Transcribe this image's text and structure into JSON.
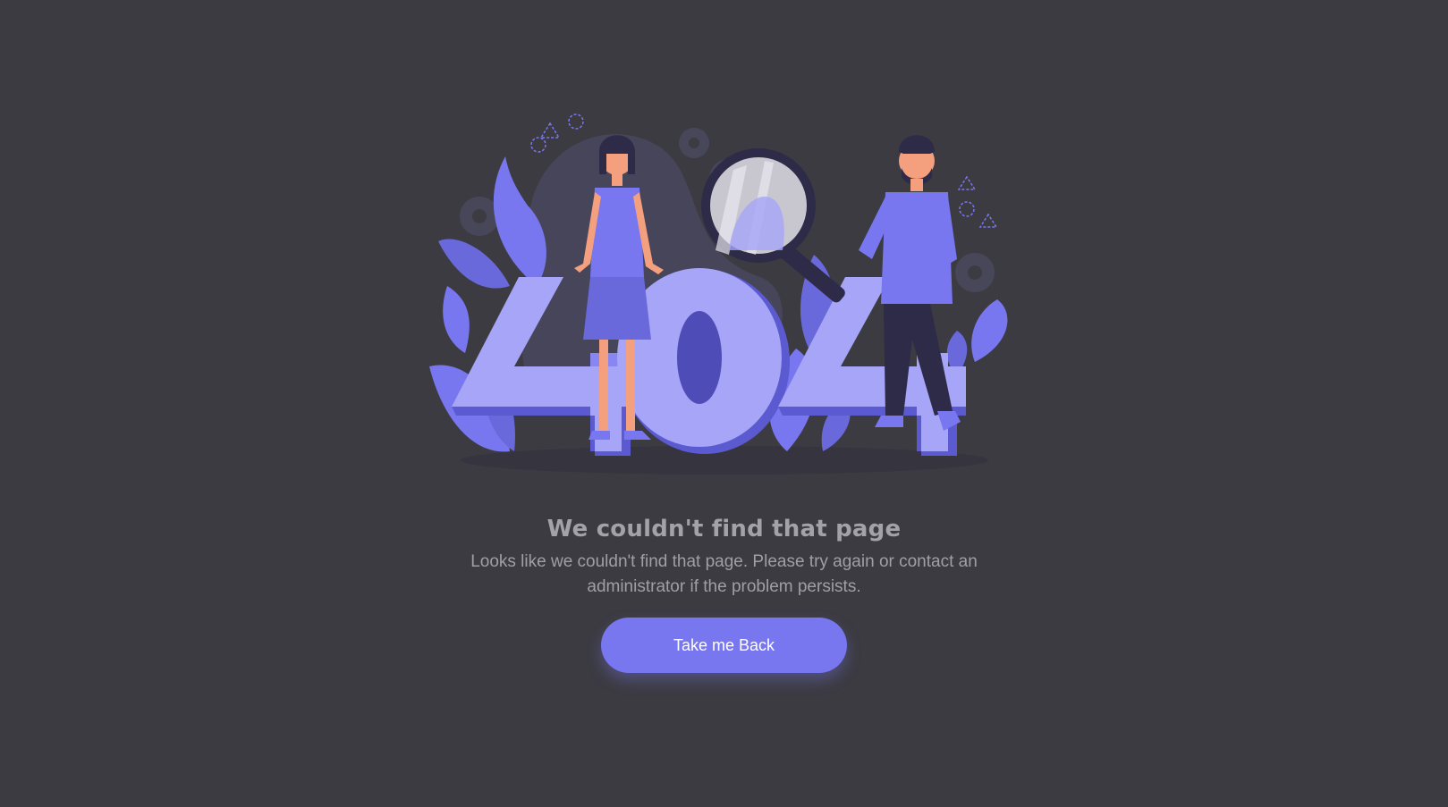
{
  "illustration": {
    "text": "404",
    "accent": "#7877ef",
    "light_accent": "#a6a5f7",
    "dark_accent": "#4e4db8",
    "background": "#3c3b42"
  },
  "error": {
    "title": "We couldn't find that page",
    "message": "Looks like we couldn't find that page. Please try again or contact an administrator if the problem persists."
  },
  "actions": {
    "back_label": "Take me Back"
  }
}
